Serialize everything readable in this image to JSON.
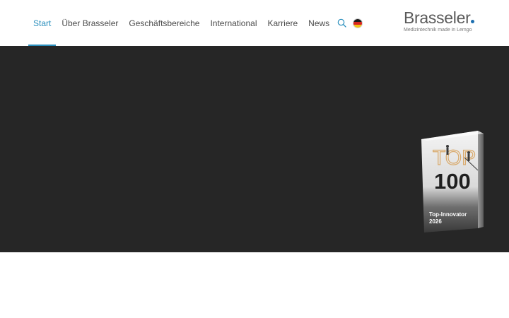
{
  "nav": {
    "items": [
      {
        "label": "Start",
        "active": true
      },
      {
        "label": "Über Brasseler",
        "active": false
      },
      {
        "label": "Geschäftsbereiche",
        "active": false
      },
      {
        "label": "International",
        "active": false
      },
      {
        "label": "Karriere",
        "active": false
      },
      {
        "label": "News",
        "active": false
      }
    ],
    "search_icon": "search-icon",
    "language_icon": "german-flag-icon"
  },
  "logo": {
    "wordmark": "Brasseler",
    "tagline": "Medizintechnik made in Lemgo"
  },
  "badge": {
    "top_text": "TOP",
    "number_text": "100",
    "line1": "Top-Innovator",
    "line2": "2026"
  },
  "colors": {
    "accent": "#2a8fbd",
    "hero_background": "#262626",
    "logo_dot": "#1d6fb0"
  }
}
